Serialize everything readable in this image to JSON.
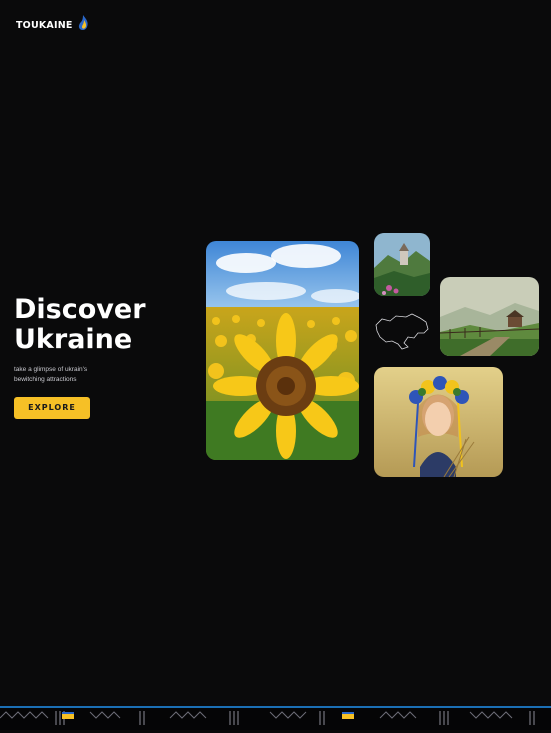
{
  "brand": {
    "name": "TOUKAINE",
    "logo_icon": "flame-icon",
    "colors": {
      "blue": "#2a67c9",
      "yellow": "#f6c026"
    }
  },
  "hero": {
    "title_line1": "Discover",
    "title_line2": "Ukraine",
    "subtitle": "take a glimpse of ukrain's bewitching attractions",
    "cta_label": "EXPLORE"
  },
  "gallery": {
    "items": [
      "sunflower-field",
      "mountain-castle",
      "ukraine-map",
      "misty-village",
      "girl-flower-wreath"
    ]
  }
}
